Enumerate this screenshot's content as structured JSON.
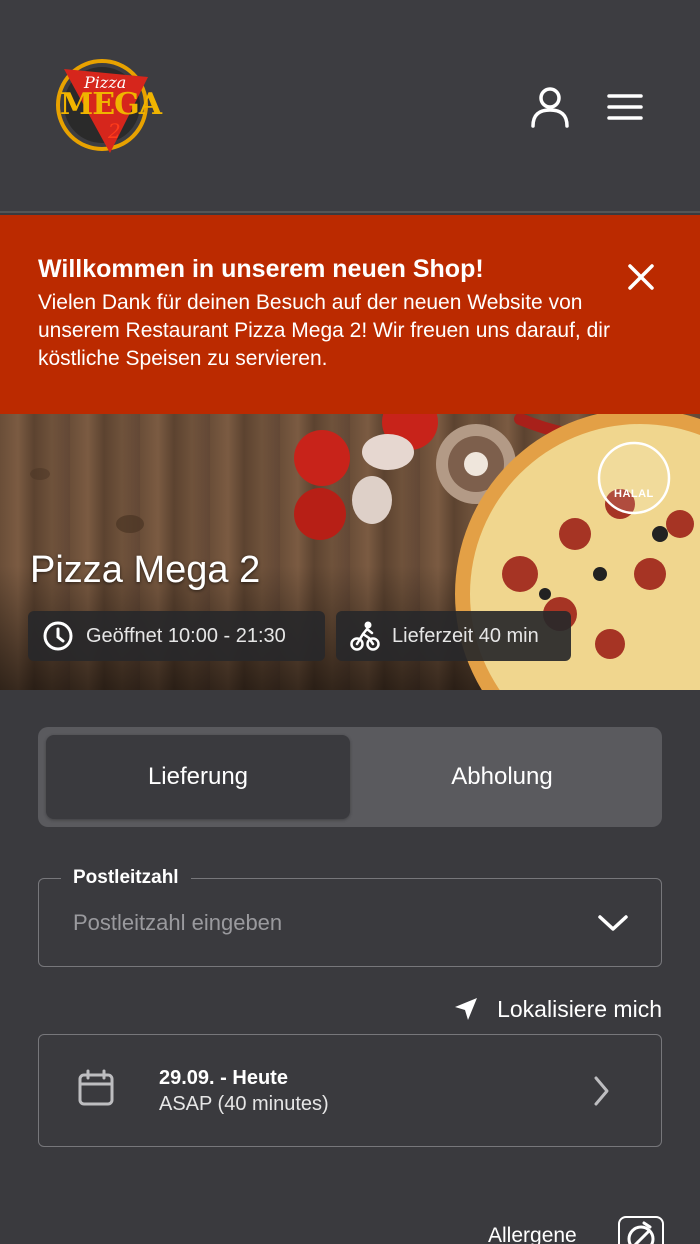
{
  "header": {
    "logo_text_top": "Pizza",
    "logo_text_main": "MEGA",
    "logo_text_num": "2",
    "user_icon": "user-icon",
    "menu_icon": "hamburger-menu-icon"
  },
  "banner": {
    "title": "Willkommen in unserem neuen Shop!",
    "text": "Vielen Dank für deinen Besuch auf der neuen Website von unserem Restaurant Pizza Mega 2! Wir freuen uns darauf, dir köstliche Speisen zu servieren.",
    "close_icon": "close-icon",
    "color": "#bb2a00"
  },
  "hero": {
    "title": "Pizza Mega 2",
    "halal_badge": "HALAL",
    "opening_hours": "Geöffnet 10:00 - 21:30",
    "delivery_time": "Lieferzeit 40 min"
  },
  "order_mode": {
    "options": [
      "Lieferung",
      "Abholung"
    ],
    "selected": "Lieferung"
  },
  "postcode": {
    "label": "Postleitzahl",
    "placeholder": "Postleitzahl eingeben",
    "value": ""
  },
  "locate": {
    "label": "Lokalisiere mich"
  },
  "schedule": {
    "date": "29.09. - Heute",
    "time": "ASAP (40 minutes)"
  },
  "allergens": {
    "label": "Allergene"
  }
}
